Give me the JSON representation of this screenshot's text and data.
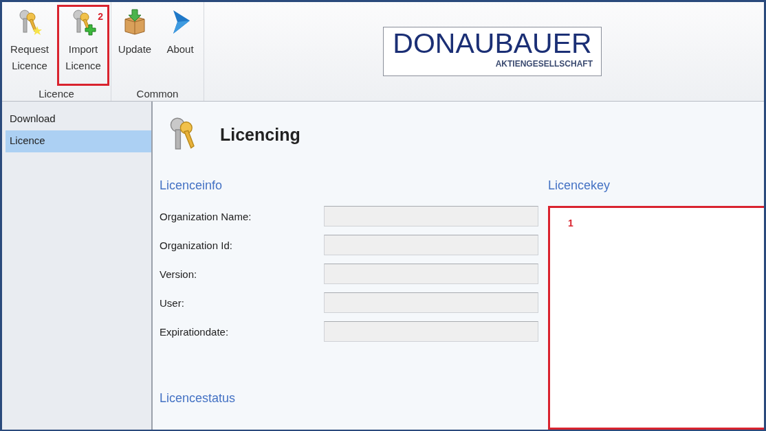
{
  "ribbon": {
    "groups": [
      {
        "label": "Licence",
        "buttons": [
          {
            "label": "Request Licence",
            "kind": "key-star",
            "highlighted": false
          },
          {
            "label": "Import Licence",
            "kind": "key-plus",
            "highlighted": true,
            "marker": "2"
          }
        ]
      },
      {
        "label": "Common",
        "buttons": [
          {
            "label": "Update",
            "kind": "package",
            "highlighted": false
          },
          {
            "label": "About",
            "kind": "triangle",
            "highlighted": false
          }
        ]
      }
    ],
    "logo": {
      "name": "DONAUBAUER",
      "subtitle": "AKTIENGESELLSCHAFT"
    }
  },
  "sidebar": {
    "items": [
      {
        "label": "Download",
        "selected": false
      },
      {
        "label": "Licence",
        "selected": true
      }
    ]
  },
  "page": {
    "title": "Licencing",
    "info": {
      "title": "Licenceinfo",
      "fields": [
        {
          "label": "Organization Name:"
        },
        {
          "label": "Organization Id:"
        },
        {
          "label": "Version:"
        },
        {
          "label": "User:"
        },
        {
          "label": "Expirationdate:"
        }
      ]
    },
    "status": {
      "title": "Licencestatus"
    },
    "key": {
      "title": "Licencekey",
      "highlighted": true,
      "marker": "1"
    }
  }
}
